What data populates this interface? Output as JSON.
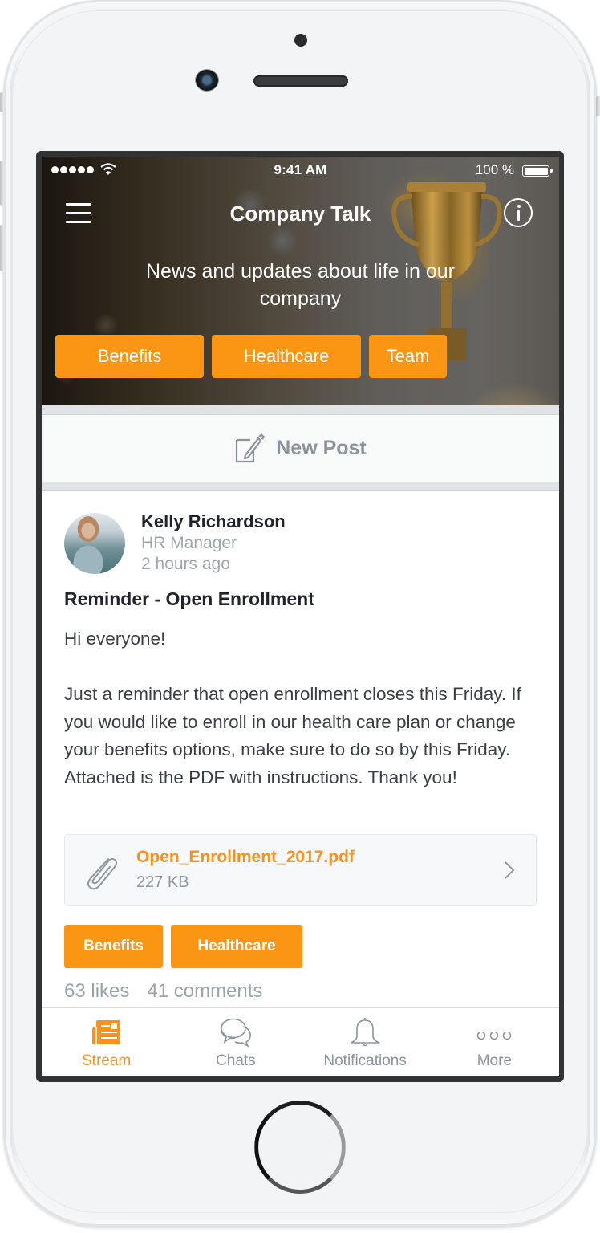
{
  "status_bar": {
    "time": "9:41 AM",
    "battery_percent": "100 %",
    "signal_bars": 5,
    "battery_level": 1.0
  },
  "header": {
    "title": "Company Talk",
    "menu_icon": "hamburger-icon",
    "info_icon": "info-icon",
    "subtitle": "News and updates about life in our company",
    "tags": [
      {
        "label": "Benefits"
      },
      {
        "label": "Healthcare"
      },
      {
        "label": "Team"
      }
    ]
  },
  "new_post": {
    "label": "New Post",
    "icon": "edit-icon"
  },
  "post": {
    "author": "Kelly Richardson",
    "role": "HR Manager",
    "time": "2 hours ago",
    "title": "Reminder -  Open Enrollment",
    "body": "Hi everyone!\n\nJust a reminder that open enrollment closes this Friday. If you would like to enroll in our health care plan or change your benefits options, make sure to do so by this Friday. Attached is the PDF with instructions. Thank you!",
    "attachment": {
      "file_name": "Open_Enrollment_2017.pdf",
      "file_size": "227 KB",
      "icon": "paperclip-icon"
    },
    "tags": [
      {
        "label": "Benefits"
      },
      {
        "label": "Healthcare"
      }
    ],
    "likes": "63 likes",
    "comments": "41 comments"
  },
  "tab_bar": {
    "active": "stream",
    "tabs": [
      {
        "id": "stream",
        "label": "Stream",
        "icon": "newspaper-icon"
      },
      {
        "id": "chats",
        "label": "Chats",
        "icon": "chat-bubbles-icon"
      },
      {
        "id": "notifications",
        "label": "Notifications",
        "icon": "bell-icon"
      },
      {
        "id": "more",
        "label": "More",
        "icon": "more-dots-icon"
      }
    ]
  },
  "colors": {
    "accent": "#fb9514",
    "accent_text": "#f7921e",
    "muted_text": "#8a949c",
    "primary_text": "#20242a"
  }
}
